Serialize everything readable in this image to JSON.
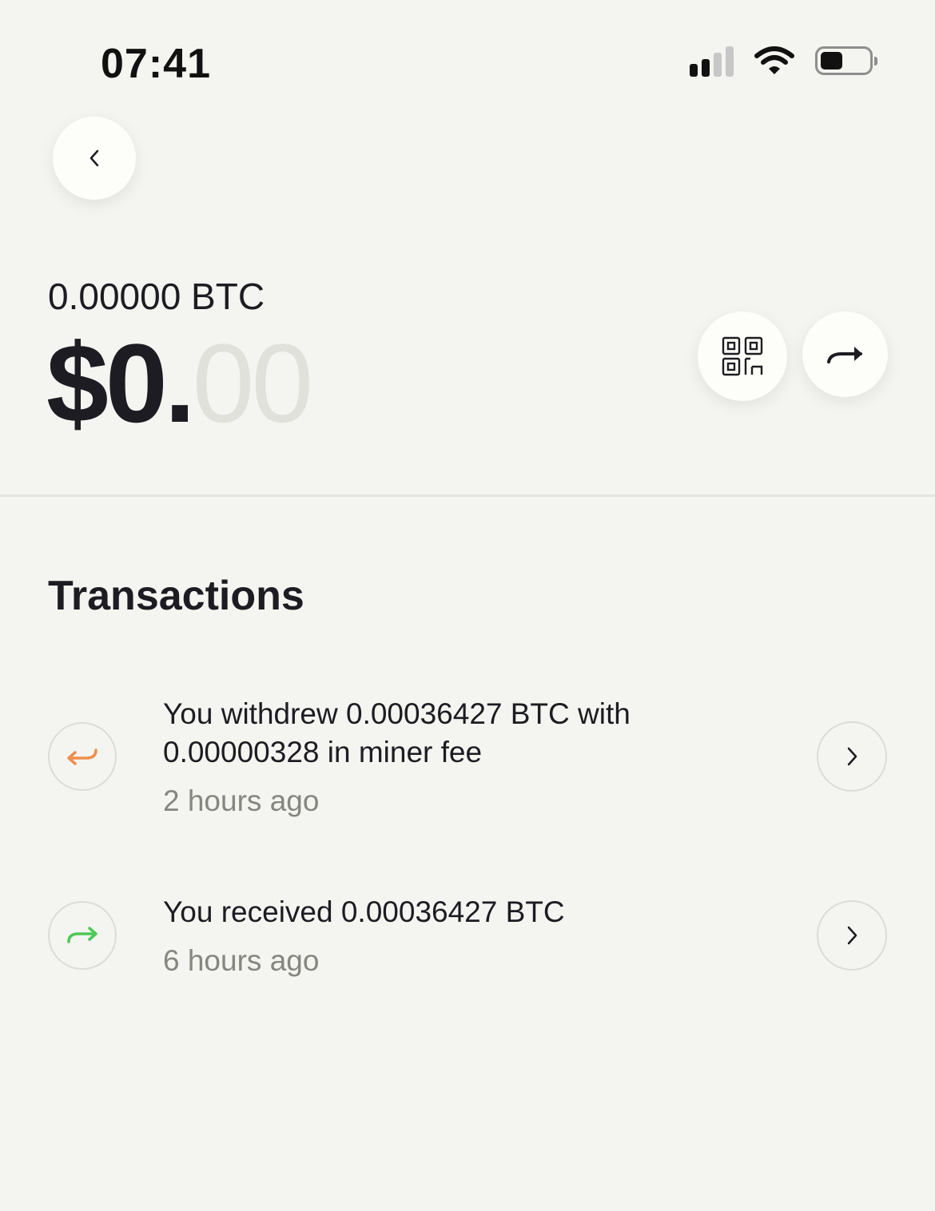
{
  "status_bar": {
    "time": "07:41"
  },
  "wallet": {
    "btc_amount": "0.00000 BTC",
    "usd_main": "$0.",
    "usd_cents": "00"
  },
  "transactions": {
    "title": "Transactions",
    "items": [
      {
        "type": "withdraw",
        "text": "You withdrew 0.00036427 BTC with 0.00000328 in miner fee",
        "time": "2 hours ago",
        "icon": "withdraw-arrow-icon",
        "color": "#ee8f4c"
      },
      {
        "type": "receive",
        "text": "You received 0.00036427 BTC",
        "time": "6 hours ago",
        "icon": "receive-arrow-icon",
        "color": "#4cc856"
      }
    ]
  },
  "colors": {
    "background": "#f4f4f1",
    "text": "#1c1c22",
    "muted_text": "#86867f",
    "cents_placeholder": "#e1e1dc"
  }
}
